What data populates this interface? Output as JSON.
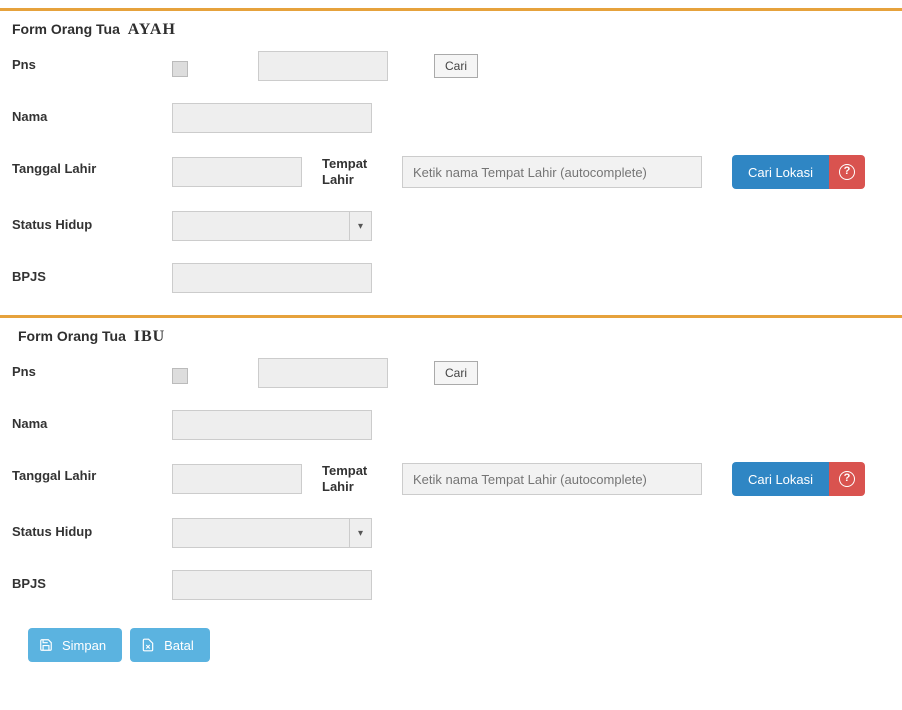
{
  "form_ayah": {
    "title_prefix": "Form Orang Tua",
    "role": "AYAH",
    "labels": {
      "pns": "Pns",
      "nama": "Nama",
      "tanggal_lahir": "Tanggal Lahir",
      "tempat_lahir": "Tempat Lahir",
      "status_hidup": "Status Hidup",
      "bpjs": "BPJS"
    },
    "values": {
      "pns_checked": false,
      "pns_code": "",
      "nama": "",
      "tanggal_lahir": "",
      "tempat_lahir": "",
      "status_hidup": "",
      "bpjs": ""
    },
    "buttons": {
      "cari": "Cari",
      "cari_lokasi": "Cari Lokasi"
    },
    "placeholders": {
      "tempat_lahir": "Ketik nama Tempat Lahir (autocomplete)"
    }
  },
  "form_ibu": {
    "title_prefix": "Form Orang Tua",
    "role": "IBU",
    "labels": {
      "pns": "Pns",
      "nama": "Nama",
      "tanggal_lahir": "Tanggal Lahir",
      "tempat_lahir": "Tempat Lahir",
      "status_hidup": "Status Hidup",
      "bpjs": "BPJS"
    },
    "values": {
      "pns_checked": false,
      "pns_code": "",
      "nama": "",
      "tanggal_lahir": "",
      "tempat_lahir": "",
      "status_hidup": "",
      "bpjs": ""
    },
    "buttons": {
      "cari": "Cari",
      "cari_lokasi": "Cari Lokasi"
    },
    "placeholders": {
      "tempat_lahir": "Ketik nama Tempat Lahir (autocomplete)"
    }
  },
  "footer": {
    "simpan": "Simpan",
    "batal": "Batal"
  },
  "colors": {
    "accent": "#e6a23c",
    "primary": "#2f86c4",
    "danger": "#d9534f",
    "action": "#5bb3e0"
  }
}
